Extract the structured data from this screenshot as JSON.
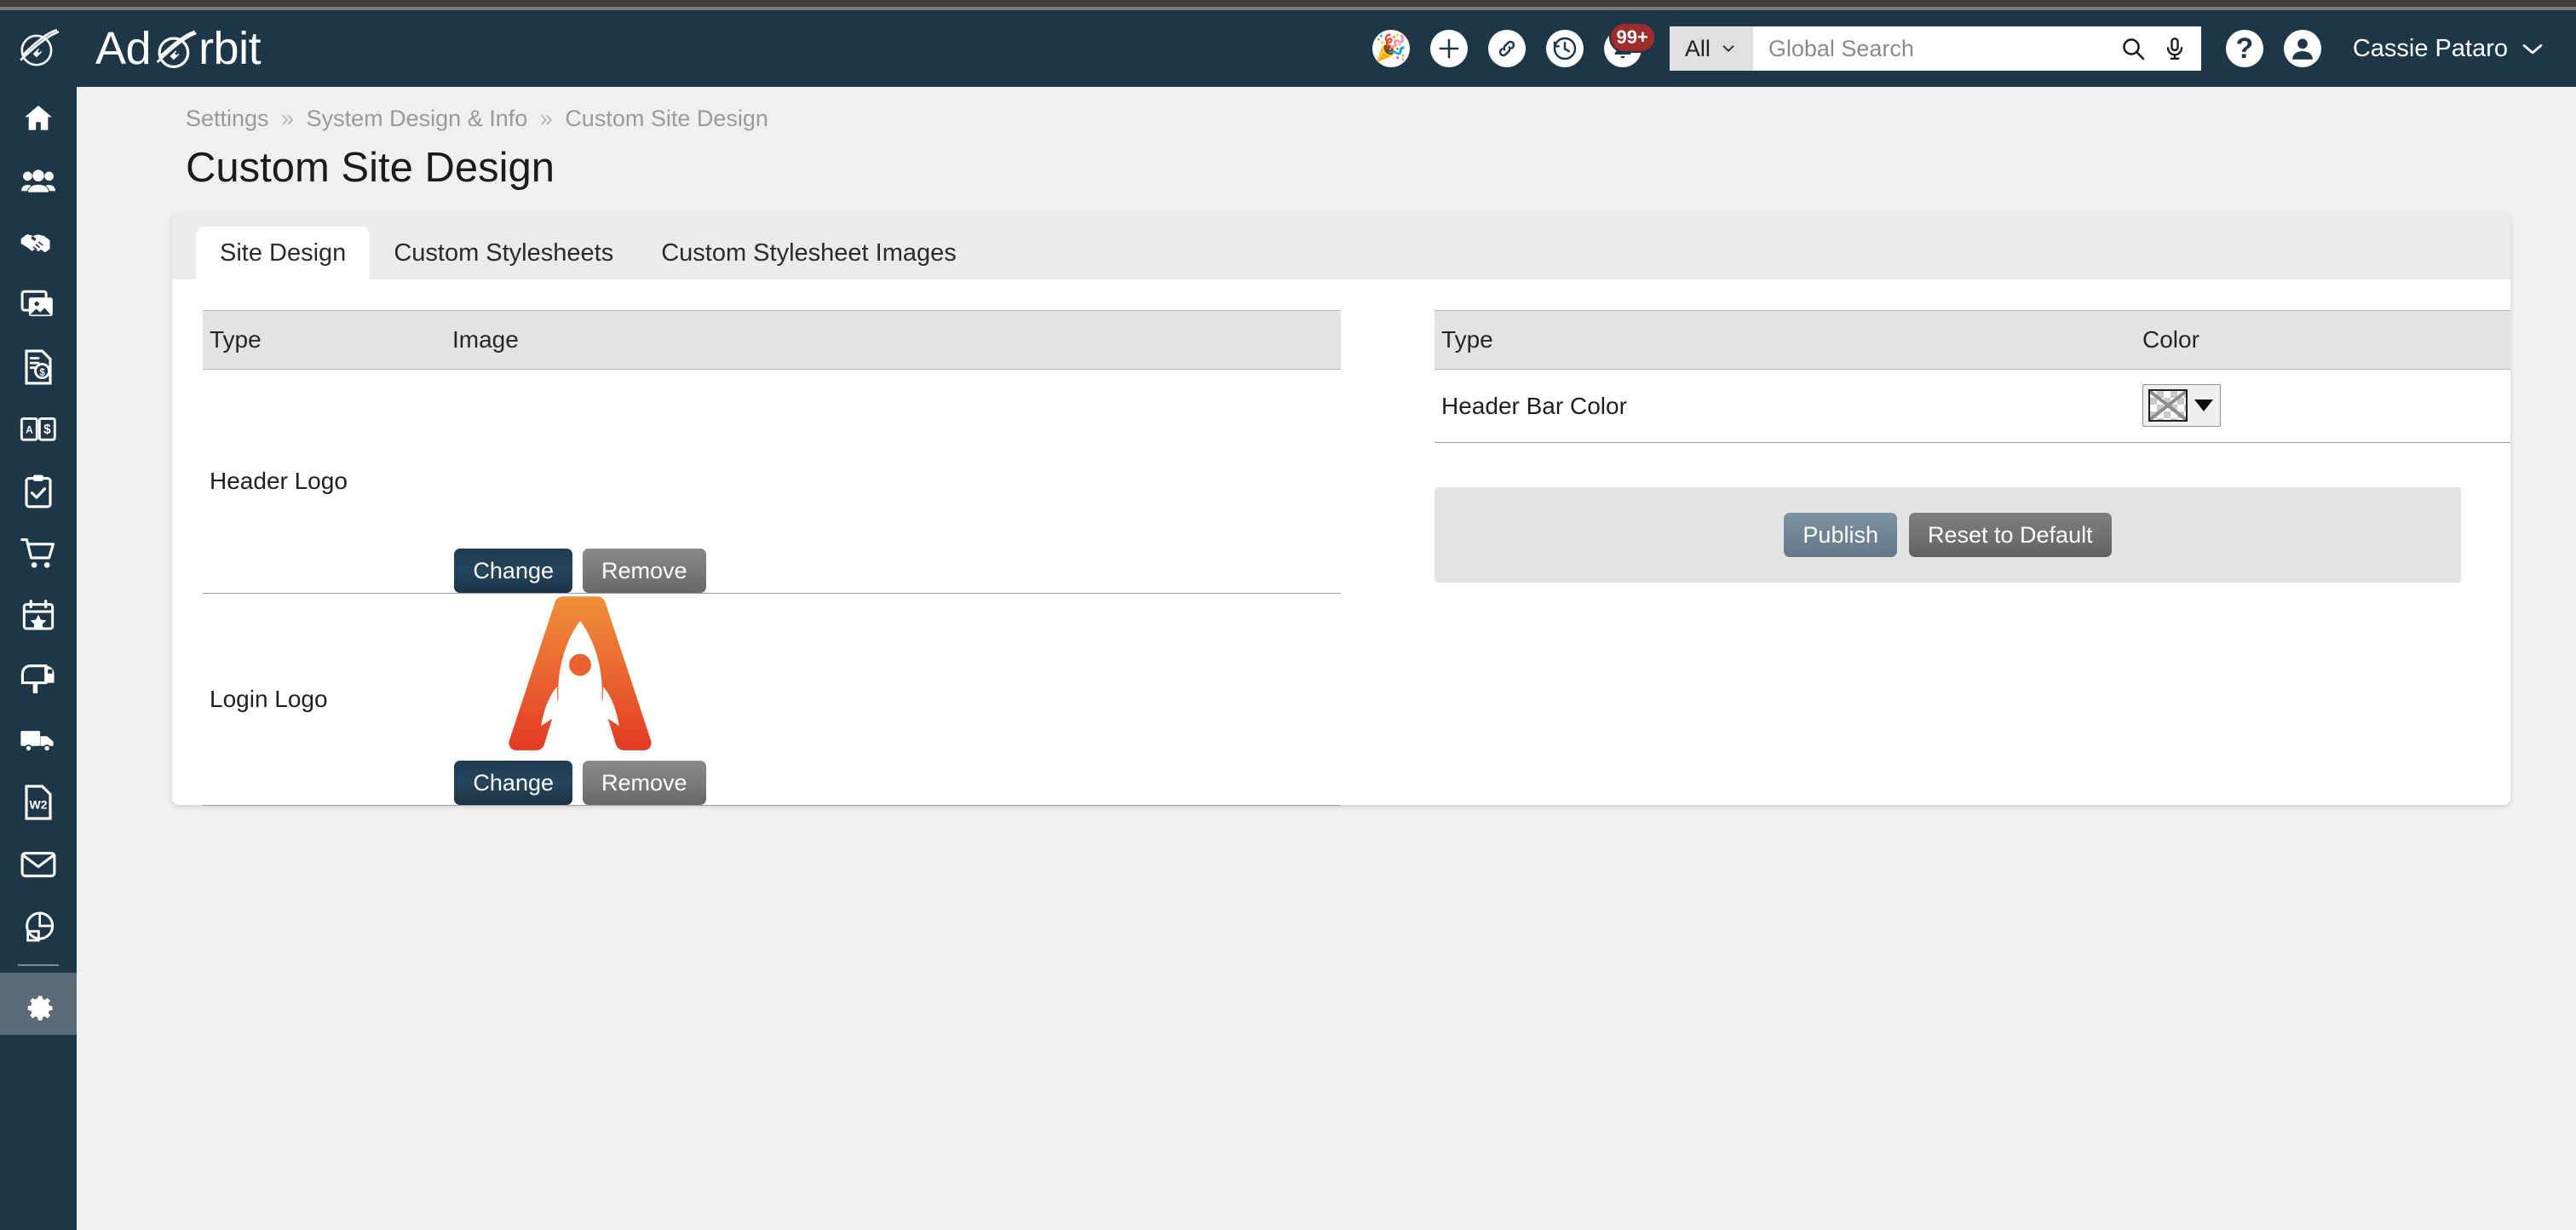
{
  "app": {
    "brand_prefix": "Ad",
    "brand_suffix": "rbit",
    "logo_icon": "planet-rocket-icon"
  },
  "header": {
    "bar_color": "#1d3648",
    "icons": [
      {
        "name": "celebration-icon",
        "glyph": "🎉"
      },
      {
        "name": "add-icon",
        "glyph": "+"
      },
      {
        "name": "link-icon",
        "glyph": "🔗"
      },
      {
        "name": "history-icon",
        "glyph": "↺"
      },
      {
        "name": "notifications-bell-icon",
        "glyph": "🔔",
        "badge": "99+"
      }
    ],
    "notification_badge": "99+",
    "search": {
      "scope_label": "All",
      "placeholder": "Global Search",
      "value": "",
      "search_icon": "search-icon",
      "mic_icon": "microphone-icon"
    },
    "help_label": "?",
    "user": {
      "name": "Cassie Pataro",
      "avatar_icon": "user-avatar-icon",
      "chevron_icon": "chevron-down-icon"
    }
  },
  "sidebar": {
    "items": [
      {
        "name": "sidebar-item-home",
        "icon": "home-icon"
      },
      {
        "name": "sidebar-item-contacts",
        "icon": "users-icon"
      },
      {
        "name": "sidebar-item-deals",
        "icon": "handshake-icon"
      },
      {
        "name": "sidebar-item-media",
        "icon": "images-icon"
      },
      {
        "name": "sidebar-item-invoices",
        "icon": "invoice-dollar-icon"
      },
      {
        "name": "sidebar-item-ap-ar",
        "icon": "ap-ar-book-icon"
      },
      {
        "name": "sidebar-item-tasks",
        "icon": "clipboard-check-icon"
      },
      {
        "name": "sidebar-item-orders",
        "icon": "shopping-cart-icon"
      },
      {
        "name": "sidebar-item-events",
        "icon": "calendar-star-icon"
      },
      {
        "name": "sidebar-item-mailbox",
        "icon": "mailbox-icon"
      },
      {
        "name": "sidebar-item-shipping",
        "icon": "truck-icon"
      },
      {
        "name": "sidebar-item-w2",
        "icon": "w2-document-icon"
      },
      {
        "name": "sidebar-item-email",
        "icon": "envelope-icon"
      },
      {
        "name": "sidebar-item-reports",
        "icon": "pie-chart-icon"
      }
    ],
    "settings": {
      "name": "sidebar-item-settings",
      "icon": "gear-icon",
      "active": true
    }
  },
  "breadcrumb": {
    "items": [
      "Settings",
      "System Design & Info",
      "Custom Site Design"
    ],
    "separator": "»"
  },
  "page": {
    "title": "Custom Site Design"
  },
  "tabs": [
    {
      "label": "Site Design",
      "active": true
    },
    {
      "label": "Custom Stylesheets",
      "active": false
    },
    {
      "label": "Custom Stylesheet Images",
      "active": false
    }
  ],
  "images_table": {
    "columns": [
      "Type",
      "Image"
    ],
    "rows": [
      {
        "type": "Header Logo",
        "has_image": false,
        "change_label": "Change",
        "remove_label": "Remove"
      },
      {
        "type": "Login Logo",
        "has_image": true,
        "image_alt": "adorbit-rocket-logo",
        "change_label": "Change",
        "remove_label": "Remove"
      }
    ]
  },
  "colors_table": {
    "columns": [
      "Type",
      "Color"
    ],
    "rows": [
      {
        "type": "Header Bar Color",
        "swatch_state": "none-selected",
        "dropdown_icon": "caret-down-icon"
      }
    ]
  },
  "actions": {
    "publish_label": "Publish",
    "reset_label": "Reset to Default"
  },
  "theme": {
    "header_bg": "#1d3648",
    "sidebar_bg": "#1d3648",
    "sidebar_active": "#5c6b78",
    "page_bg": "#f0f0f0",
    "card_bg": "#ffffff",
    "tab_bar_bg": "#ebebeb",
    "table_header_bg": "#e3e3e3",
    "btn_dark": "#22415a",
    "btn_gray": "#7a7a7a",
    "btn_publish": "#708495",
    "badge_red": "#a02b2b",
    "logo_orange": "#ef8033",
    "logo_red": "#e33f26"
  }
}
